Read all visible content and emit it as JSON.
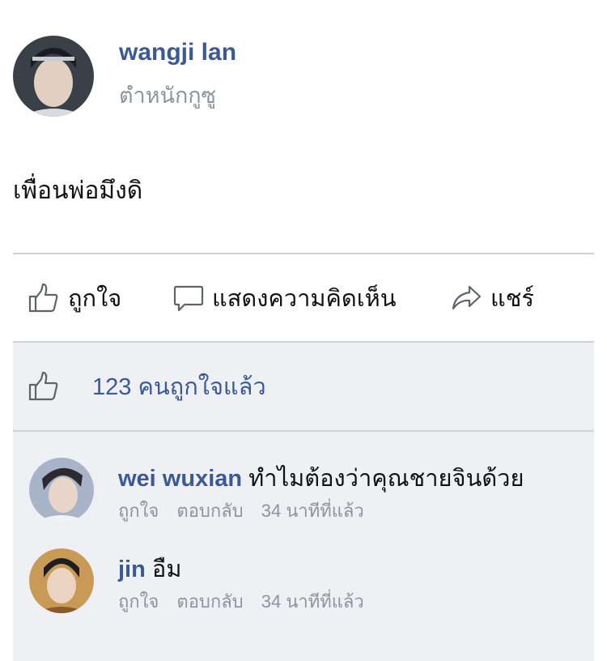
{
  "post": {
    "author": "wangji lan",
    "subtitle": "ตำหนักกูซู",
    "text": "เพื่อนพ่อมึงดิ"
  },
  "actions": {
    "like": "ถูกใจ",
    "comment": "แสดงความคิดเห็น",
    "share": "แชร์"
  },
  "likes": {
    "text": "123 คนถูกใจแล้ว"
  },
  "comments": [
    {
      "name": "wei wuxian",
      "text": "ทำไมต้องว่าคุณชายจินด้วย",
      "like": "ถูกใจ",
      "reply": "ตอบกลับ",
      "time": "34 นาทีที่แล้ว"
    },
    {
      "name": "jin",
      "text": "อืม",
      "like": "ถูกใจ",
      "reply": "ตอบกลับ",
      "time": "34 นาทีที่แล้ว"
    }
  ],
  "colors": {
    "link_blue": "#3b5998",
    "muted_gray": "#8d949e",
    "panel_bg": "#eef0f4",
    "divider": "#cfd1d5"
  },
  "icons": {
    "like": "thumbs-up-icon",
    "comment": "speech-bubble-icon",
    "share": "share-arrow-icon"
  }
}
